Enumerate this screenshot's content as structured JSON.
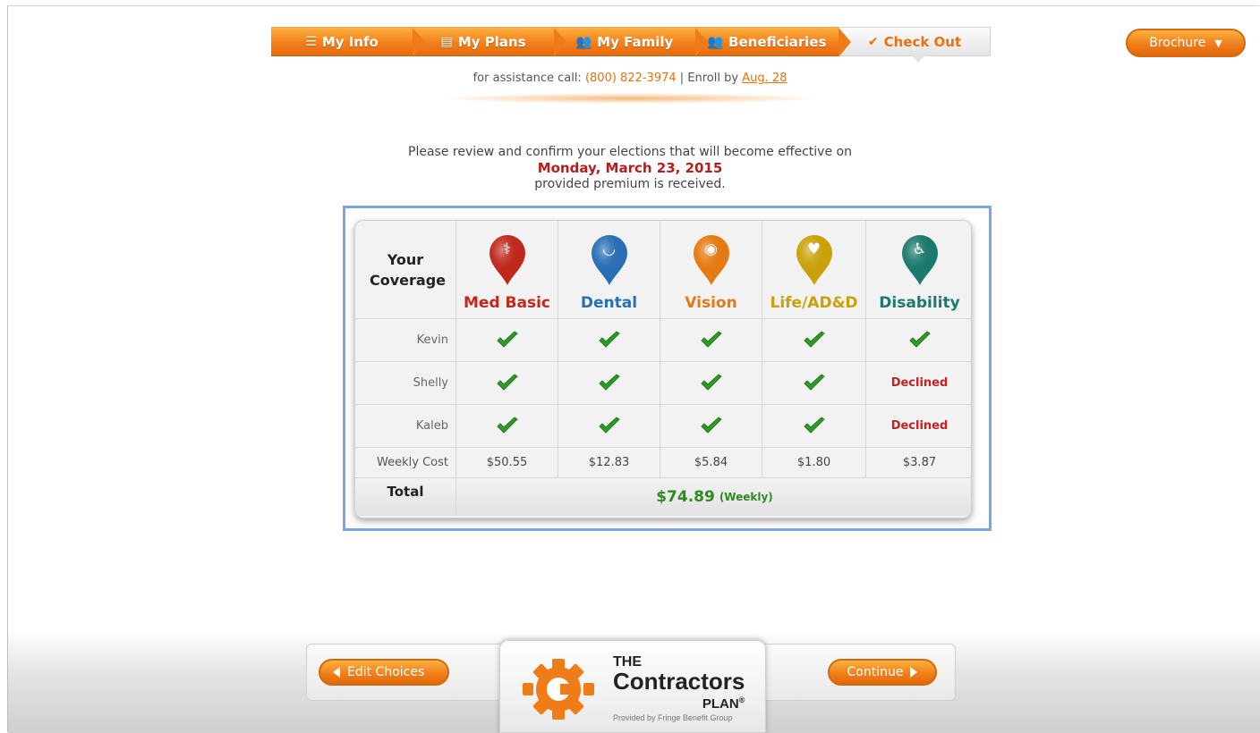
{
  "nav": {
    "steps": [
      {
        "label": "My Info",
        "icon": "list-icon"
      },
      {
        "label": "My Plans",
        "icon": "document-icon"
      },
      {
        "label": "My Family",
        "icon": "family-icon"
      },
      {
        "label": "Beneficiaries",
        "icon": "beneficiaries-icon"
      },
      {
        "label": "Check Out",
        "icon": "checkmark-icon"
      }
    ],
    "active_step": "Check Out",
    "brochure_label": "Brochure"
  },
  "assist": {
    "prefix": "for assistance call: ",
    "phone": "(800) 822-3974",
    "enroll_text": " | Enroll by ",
    "enroll_date": "Aug. 28"
  },
  "review": {
    "line1": "Please review and confirm your elections that will become effective on",
    "date": "Monday, March 23, 2015",
    "line3": "provided premium is received."
  },
  "coverage": {
    "heading": "Your Coverage",
    "plans": [
      {
        "label": "Med Basic",
        "color": "#c0281d",
        "icon": "medical-icon"
      },
      {
        "label": "Dental",
        "color": "#2a6fb5",
        "icon": "tooth-icon"
      },
      {
        "label": "Vision",
        "color": "#e67a12",
        "icon": "eye-icon"
      },
      {
        "label": "Life/AD&D",
        "color": "#c9a20a",
        "icon": "heart-icon"
      },
      {
        "label": "Disability",
        "color": "#1b7a6e",
        "icon": "wheelchair-icon"
      }
    ],
    "members": [
      {
        "name": "Kevin",
        "status": [
          "check",
          "check",
          "check",
          "check",
          "check"
        ]
      },
      {
        "name": "Shelly",
        "status": [
          "check",
          "check",
          "check",
          "check",
          "Declined"
        ]
      },
      {
        "name": "Kaleb",
        "status": [
          "check",
          "check",
          "check",
          "check",
          "Declined"
        ]
      }
    ],
    "weekly_cost_label": "Weekly Cost",
    "weekly_costs": [
      "$50.55",
      "$12.83",
      "$5.84",
      "$1.80",
      "$3.87"
    ],
    "total_label": "Total",
    "total_amount": "$74.89",
    "total_unit": "(Weekly)"
  },
  "footer": {
    "edit_label": "Edit Choices",
    "continue_label": "Continue",
    "logo": {
      "line1": "THE",
      "line2": "Contractors",
      "line3": "PLAN",
      "reg": "®",
      "tagline": "Provided by Fringe Benefit Group"
    }
  },
  "colors": {
    "accent_orange": "#f07c18",
    "declined_red": "#c62020",
    "total_green": "#2f8a22",
    "highlight_blue": "#7aa7dd"
  }
}
